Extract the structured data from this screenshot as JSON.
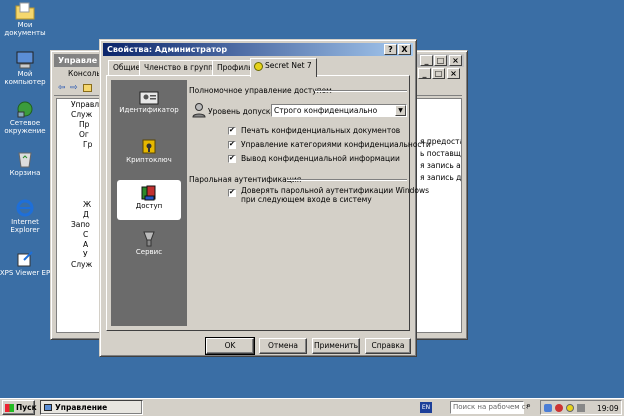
{
  "desktop": {
    "icons": [
      {
        "label": "Мои документы",
        "icon": "folder-documents-icon"
      },
      {
        "label": "Мой компьютер",
        "icon": "computer-icon"
      },
      {
        "label": "Сетевое окружение",
        "icon": "network-icon"
      },
      {
        "label": "Корзина",
        "icon": "recycle-bin-icon"
      },
      {
        "label": "Internet Explorer",
        "icon": "ie-icon"
      },
      {
        "label": "XPS Viewer EP",
        "icon": "xps-icon"
      }
    ]
  },
  "bg_window": {
    "title": "Управле",
    "console_title": "Консоль",
    "tree_items": [
      "Управлен",
      "Служ",
      "Пр",
      "Ог",
      "Гр",
      "Ж",
      "Д",
      "Запо",
      "С",
      "А",
      "У",
      "Служ"
    ],
    "right_lines": [
      "я предоставл",
      "ь поставщика",
      "я запись адм",
      "я запись для ."
    ]
  },
  "dialog": {
    "title": "Свойства: Администратор",
    "title_help": "?",
    "title_close": "X",
    "tabs": [
      "Общие",
      "Членство в группах",
      "Профиль",
      "Secret Net 7"
    ],
    "side": [
      "Идентификатор",
      "Криптоключ",
      "Доступ",
      "Сервис"
    ],
    "group1": "Полномочное управление доступом",
    "level_label": "Уровень допуска:",
    "level_value": "Строго конфиденциально",
    "checks": [
      "Печать конфиденциальных документов",
      "Управление категориями конфиденциальности",
      "Вывод конфиденциальной информации"
    ],
    "group2": "Парольная аутентификация",
    "trust_line1": "Доверять парольной аутентификации Windows",
    "trust_line2": "при следующем входе в систему",
    "buttons": [
      "OK",
      "Отмена",
      "Применить",
      "Справка"
    ]
  },
  "taskbar": {
    "start": "Пуск",
    "task": "Управление компью...",
    "lang": "EN",
    "search_placeholder": "Поиск на рабочем ст",
    "time": "19:09"
  }
}
